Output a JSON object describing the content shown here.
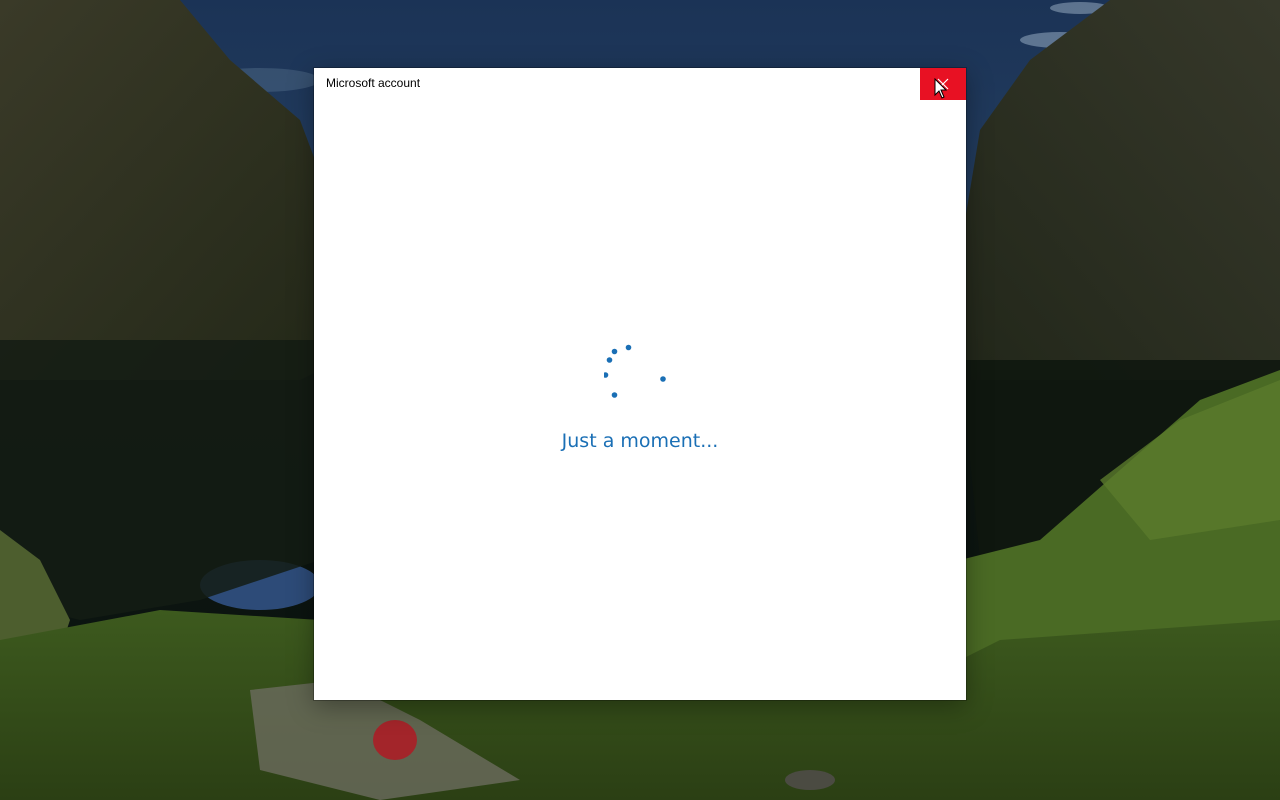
{
  "window": {
    "title": "Microsoft account",
    "close_icon": "close-icon",
    "close_hover_color": "#e81123"
  },
  "content": {
    "status_text": "Just a moment...",
    "status_color": "#1a6fb5",
    "spinner_icon": "loading-spinner-icon",
    "spinner_color": "#1a6fb5"
  },
  "desktop": {
    "wallpaper": "mountain-lake-landscape"
  }
}
